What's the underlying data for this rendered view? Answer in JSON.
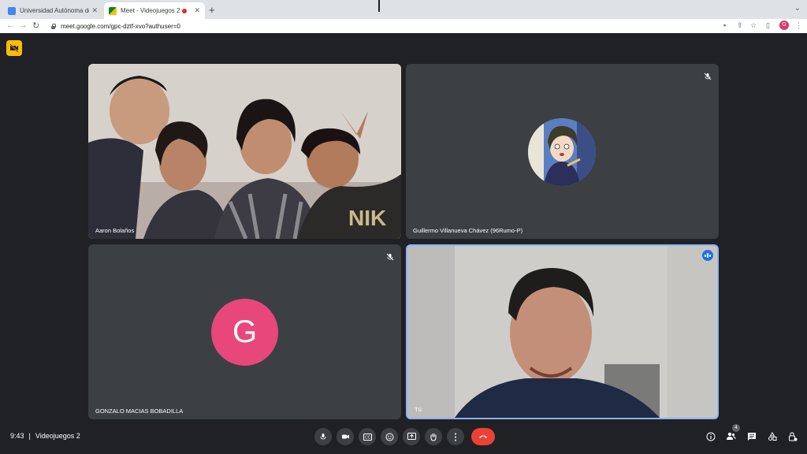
{
  "browser": {
    "tabs": [
      {
        "title": "Universidad Autónoma de Que",
        "active": false,
        "favicon_color": "#4285f4"
      },
      {
        "title": "Meet - Videojuegos 2",
        "active": true,
        "favicon_color": "#00832d"
      }
    ],
    "new_tab_label": "+",
    "url": "meet.google.com/gpc-dztf-xvo?authuser=0",
    "profile_initial": "G"
  },
  "meeting": {
    "time": "9:43",
    "separator": "|",
    "title": "Videojuegos 2",
    "participant_count": "4"
  },
  "participants": [
    {
      "name": "Aaron Bolaños",
      "type": "video",
      "muted": false
    },
    {
      "name": "Guillermo Villanueva Chávez (96Rumo-P)",
      "type": "avatar-image",
      "muted": true
    },
    {
      "name": "GONZALO MACIAS BOBADILLA",
      "type": "avatar-letter",
      "initial": "G",
      "avatar_color": "#e8477c",
      "muted": true
    },
    {
      "name": "Tú",
      "type": "video",
      "speaking": true
    }
  ],
  "controls": [
    "microphone-icon",
    "camera-icon",
    "captions-icon",
    "emoji-icon",
    "present-icon",
    "raise-hand-icon",
    "more-options-icon",
    "end-call-icon"
  ],
  "side_controls": [
    "info-icon",
    "people-icon",
    "chat-icon",
    "activities-icon",
    "host-controls-icon"
  ]
}
